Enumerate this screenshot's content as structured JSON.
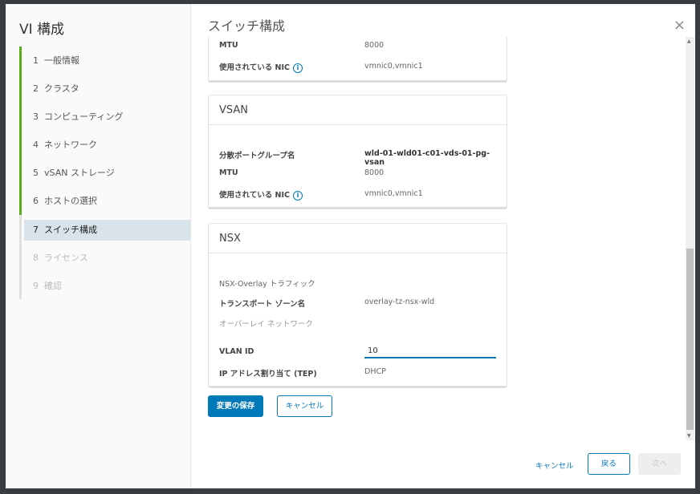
{
  "sidebar": {
    "title": "VI 構成",
    "steps": [
      {
        "num": "1",
        "label": "一般情報"
      },
      {
        "num": "2",
        "label": "クラスタ"
      },
      {
        "num": "3",
        "label": "コンピューティング"
      },
      {
        "num": "4",
        "label": "ネットワーク"
      },
      {
        "num": "5",
        "label": "vSAN ストレージ"
      },
      {
        "num": "6",
        "label": "ホストの選択"
      },
      {
        "num": "7",
        "label": "スイッチ構成"
      },
      {
        "num": "8",
        "label": "ライセンス"
      },
      {
        "num": "9",
        "label": "確認"
      }
    ]
  },
  "main": {
    "title": "スイッチ構成",
    "close": "×",
    "card_top": {
      "mtu_label": "MTU",
      "mtu": "8000",
      "nic_label": "使用されている NIC",
      "nic": "vmnic0,vmnic1"
    },
    "vsan": {
      "title": "VSAN",
      "pg_label": "分散ポートグループ名",
      "pg": "wld-01-wld01-c01-vds-01-pg-vsan",
      "mtu_label": "MTU",
      "mtu": "8000",
      "nic_label": "使用されている NIC",
      "nic": "vmnic0,vmnic1"
    },
    "nsx": {
      "title": "NSX",
      "overlay_traffic": "NSX-Overlay トラフィック",
      "tz_label": "トランスポート ゾーン名",
      "tz": "overlay-tz-nsx-wld",
      "overlay_net": "オーバーレイ ネットワーク",
      "vlan_label": "VLAN ID",
      "vlan": "10",
      "ip_label": "IP アドレス割り当て (TEP)",
      "ip": "DHCP"
    },
    "save_label": "変更の保存",
    "cancel_label": "キャンセル"
  },
  "footer": {
    "cancel": "キャンセル",
    "back": "戻る",
    "next": "次へ"
  },
  "info_icon": "i"
}
